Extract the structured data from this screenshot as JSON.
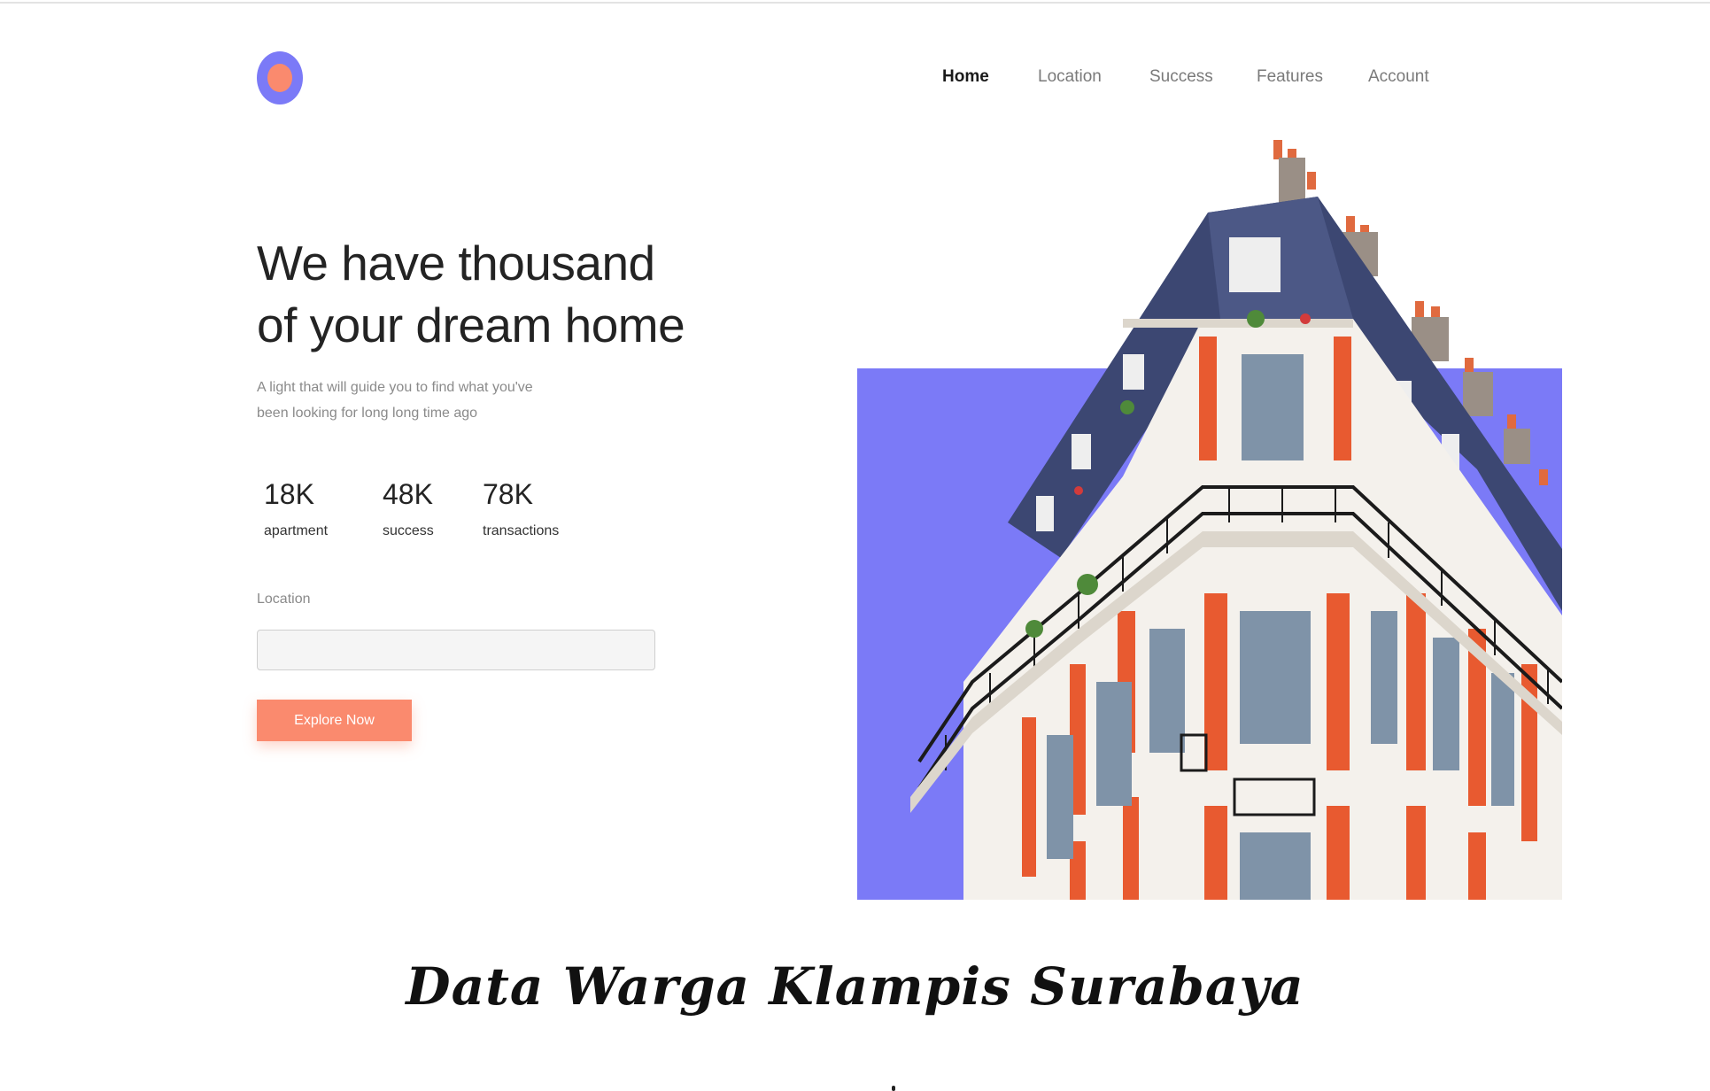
{
  "nav": {
    "items": [
      {
        "label": "Home",
        "active": true
      },
      {
        "label": "Location",
        "active": false
      },
      {
        "label": "Success",
        "active": false
      },
      {
        "label": "Features",
        "active": false
      },
      {
        "label": "Account",
        "active": false
      }
    ]
  },
  "hero": {
    "headline_line1": "We have thousand",
    "headline_line2": "of your dream home",
    "subtitle_line1": "A light that will guide you to find what you've",
    "subtitle_line2": "been looking for long long time ago"
  },
  "stats": [
    {
      "value": "18K",
      "label": "apartment"
    },
    {
      "value": "48K",
      "label": "success"
    },
    {
      "value": "78K",
      "label": "transactions"
    }
  ],
  "search": {
    "label": "Location",
    "value": "",
    "placeholder": ""
  },
  "cta": {
    "label": "Explore Now"
  },
  "section": {
    "title": "Data Warga Klampis Surabaya"
  },
  "colors": {
    "accent_orange": "#fa8a6e",
    "accent_purple": "#7b7af7"
  },
  "icons": {
    "logo": "ring-logo-icon"
  }
}
